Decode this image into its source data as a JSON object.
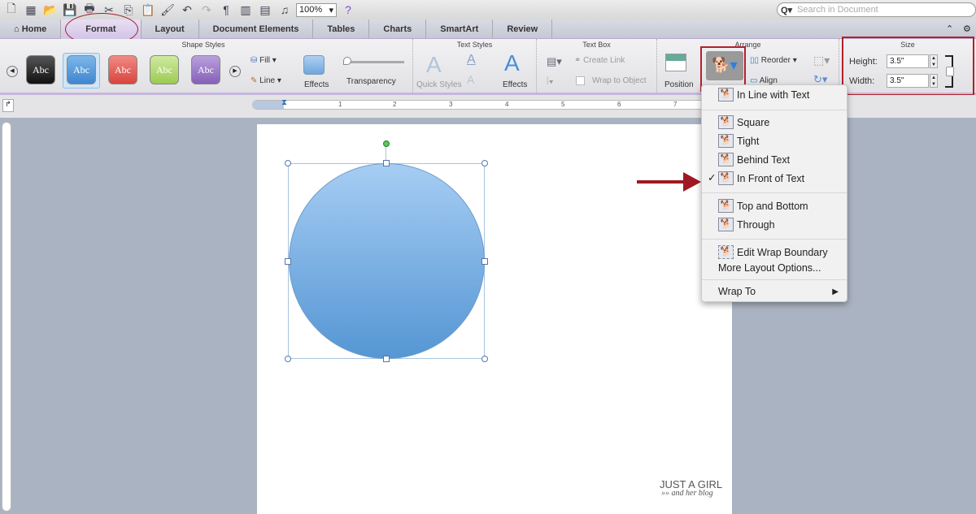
{
  "toolbar": {
    "zoom": "100%",
    "search_placeholder": "Search in Document",
    "icons": [
      "new-icon",
      "gallery-icon",
      "open-icon",
      "save-icon",
      "print-icon",
      "cut-icon",
      "copy-icon",
      "paste-icon",
      "format-painter-icon",
      "undo-icon",
      "redo-icon",
      "pilcrow-icon",
      "sidebar-icon",
      "view-icon",
      "media-icon",
      "help-icon"
    ]
  },
  "tabs": [
    {
      "label": "Home"
    },
    {
      "label": "Format"
    },
    {
      "label": "Layout"
    },
    {
      "label": "Document Elements"
    },
    {
      "label": "Tables"
    },
    {
      "label": "Charts"
    },
    {
      "label": "SmartArt"
    },
    {
      "label": "Review"
    }
  ],
  "ribbon": {
    "shape_styles": {
      "title": "Shape Styles",
      "sample": "Abc",
      "swatches": [
        "#2a2a2a",
        "#5d9fdc",
        "#e8605a",
        "#b6d96d",
        "#9d79c6"
      ],
      "fill": "Fill",
      "line": "Line",
      "effects": "Effects",
      "transparency": "Transparency"
    },
    "text_styles": {
      "title": "Text Styles",
      "quick_styles": "Quick Styles",
      "effects": "Effects"
    },
    "text_box": {
      "title": "Text Box",
      "create_link": "Create Link",
      "wrap_to_object": "Wrap to Object"
    },
    "arrange": {
      "title": "Arrange",
      "position": "Position",
      "reorder": "Reorder",
      "align": "Align"
    },
    "size": {
      "title": "Size",
      "height_label": "Height:",
      "height": "3.5\"",
      "width_label": "Width:",
      "width": "3.5\""
    }
  },
  "ruler": {
    "marks": [
      "1",
      "2",
      "3",
      "4",
      "5",
      "6",
      "7"
    ]
  },
  "wrap_menu": {
    "items": [
      {
        "label": "In Line with Text",
        "checked": false
      },
      {
        "label": "Square",
        "checked": false
      },
      {
        "label": "Tight",
        "checked": false
      },
      {
        "label": "Behind Text",
        "checked": false
      },
      {
        "label": "In Front of Text",
        "checked": true
      },
      {
        "label": "Top and Bottom",
        "checked": false
      },
      {
        "label": "Through",
        "checked": false
      },
      {
        "label": "Edit Wrap Boundary",
        "checked": false
      }
    ],
    "more": "More Layout Options...",
    "wrap_to": "Wrap To",
    "check": "✓",
    "submenu_arrow": "▶"
  },
  "watermark": {
    "line1": "JUST A GIRL",
    "line2": "and her blog"
  },
  "colors": {
    "accent_red": "#b3202a",
    "shape_top": "#a6cdf3",
    "shape_bottom": "#5596d4"
  }
}
